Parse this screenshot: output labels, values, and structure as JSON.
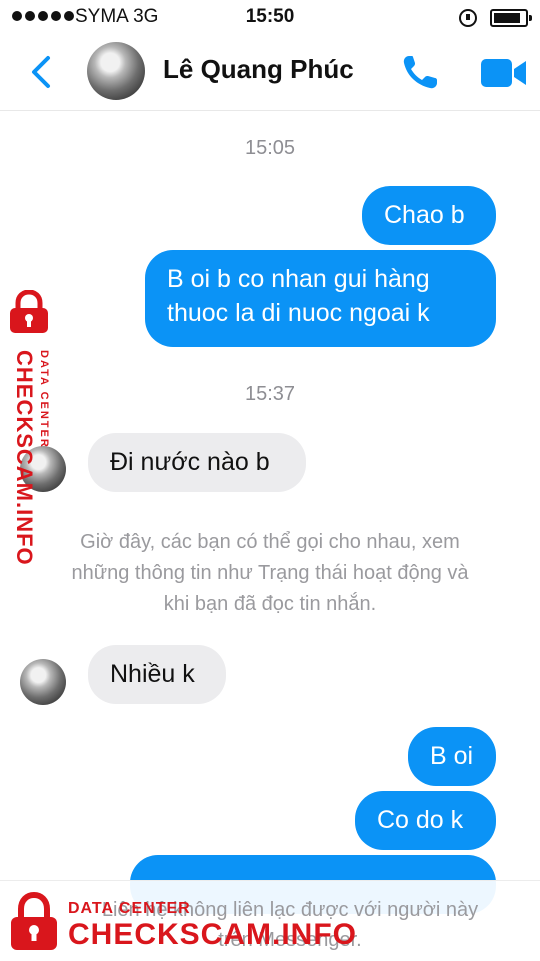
{
  "status_bar": {
    "carrier": "SYMA   3G",
    "time": "15:50",
    "battery_level": 0.85
  },
  "header": {
    "contact_name": "Lê Quang Phúc",
    "icons": [
      "back-chevron-icon",
      "phone-icon",
      "video-camera-icon"
    ],
    "accent_color": "#0b93f6"
  },
  "messages": [
    {
      "type": "timestamp",
      "text": "15:05"
    },
    {
      "type": "outgoing",
      "text": "Chao b"
    },
    {
      "type": "outgoing",
      "lines": [
        "B oi b co nhan gui hàng",
        "thuoc la di nuoc ngoai k"
      ]
    },
    {
      "type": "timestamp",
      "text": "15:37"
    },
    {
      "type": "incoming",
      "text": "Đi nước nào b"
    },
    {
      "type": "notice",
      "lines": [
        "Giờ đây, các bạn có thể gọi cho nhau, xem",
        "những thông tin như Trạng thái hoạt động và",
        "khi bạn đã đọc tin nhắn."
      ]
    },
    {
      "type": "incoming",
      "text": "Nhiều k"
    },
    {
      "type": "outgoing",
      "text": "B oi"
    },
    {
      "type": "outgoing",
      "text": "Co do k"
    }
  ],
  "bottom_bar": {
    "lines": [
      "Liên hệ không liên lạc được với người này",
      "trên Messenger."
    ]
  },
  "watermark": {
    "brand": "CHECKSCAM.INFO",
    "subtitle": "DATA CENTER",
    "color": "#d9161c"
  }
}
